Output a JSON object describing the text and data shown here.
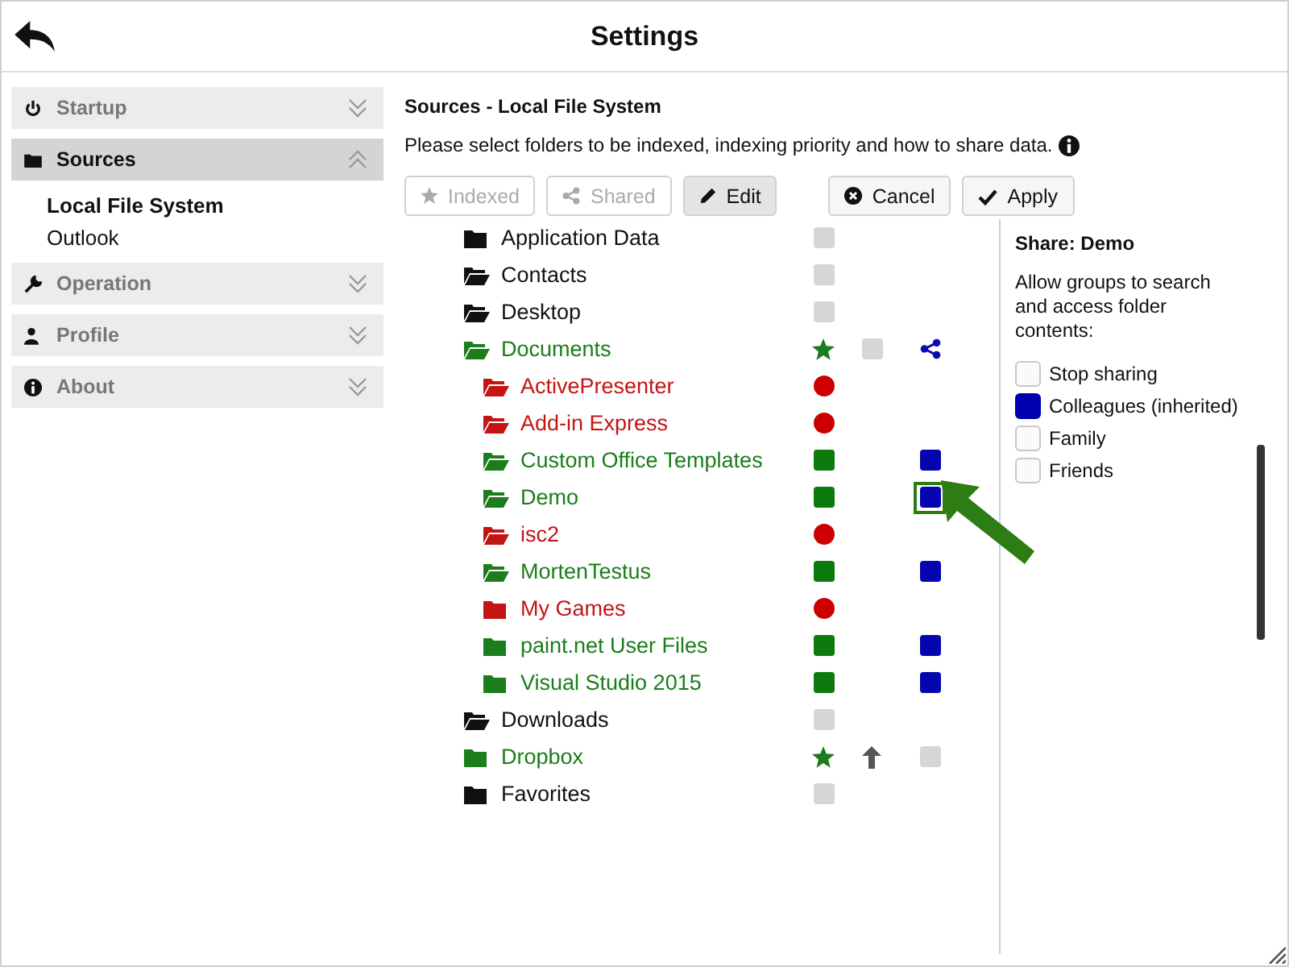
{
  "window": {
    "title": "Settings"
  },
  "sidebar": {
    "sections": [
      {
        "label": "Startup",
        "expanded": false
      },
      {
        "label": "Sources",
        "expanded": true,
        "items": [
          {
            "label": "Local File System",
            "selected": true
          },
          {
            "label": "Outlook",
            "selected": false
          }
        ]
      },
      {
        "label": "Operation",
        "expanded": false
      },
      {
        "label": "Profile",
        "expanded": false
      },
      {
        "label": "About",
        "expanded": false
      }
    ]
  },
  "content": {
    "heading": "Sources - Local File System",
    "description": "Please select folders to be indexed, indexing priority and how to share data.",
    "toolbar": [
      {
        "label": "Indexed",
        "disabled": true,
        "pressed": false
      },
      {
        "label": "Shared",
        "disabled": true,
        "pressed": false
      },
      {
        "label": "Edit",
        "disabled": false,
        "pressed": true
      }
    ],
    "actions": [
      {
        "label": "Cancel"
      },
      {
        "label": "Apply"
      }
    ],
    "tree": [
      {
        "name": "Application Data",
        "color": "#111111",
        "open": false,
        "index": {
          "kind": "inherit"
        },
        "selected": false
      },
      {
        "name": "Contacts",
        "color": "#111111",
        "open": true,
        "index": {
          "kind": "inherit"
        },
        "selected": false
      },
      {
        "name": "Desktop",
        "color": "#111111",
        "open": true,
        "index": {
          "kind": "inherit"
        },
        "selected": false
      },
      {
        "name": "Documents",
        "color": "#1b7d1b",
        "open": true,
        "index": {
          "kind": "star"
        },
        "sync": {
          "kind": "square"
        },
        "share": {
          "kind": "share"
        },
        "selected": false,
        "children": [
          {
            "name": "ActivePresenter",
            "color": "#c41414",
            "open": true,
            "index": {
              "kind": "dot"
            },
            "selected": false
          },
          {
            "name": "Add-in Express",
            "color": "#c41414",
            "open": true,
            "index": {
              "kind": "dot"
            },
            "selected": false
          },
          {
            "name": "Custom Office Templates",
            "color": "#1b7d1b",
            "open": true,
            "index": {
              "kind": "square"
            },
            "share": {
              "kind": "square"
            },
            "selected": false
          },
          {
            "name": "Demo",
            "color": "#1b7d1b",
            "open": true,
            "index": {
              "kind": "square"
            },
            "share": {
              "kind": "square"
            },
            "selected": true
          },
          {
            "name": "isc2",
            "color": "#c41414",
            "open": true,
            "index": {
              "kind": "dot"
            },
            "selected": false
          },
          {
            "name": "MortenTestus",
            "color": "#1b7d1b",
            "open": true,
            "index": {
              "kind": "square"
            },
            "share": {
              "kind": "square"
            },
            "selected": false
          },
          {
            "name": "My Games",
            "color": "#c41414",
            "open": false,
            "index": {
              "kind": "dot"
            },
            "selected": false
          },
          {
            "name": "paint.net User Files",
            "color": "#1b7d1b",
            "open": false,
            "index": {
              "kind": "square"
            },
            "share": {
              "kind": "square"
            },
            "selected": false
          },
          {
            "name": "Visual Studio 2015",
            "color": "#1b7d1b",
            "open": false,
            "index": {
              "kind": "square"
            },
            "share": {
              "kind": "square"
            },
            "selected": false
          }
        ]
      },
      {
        "name": "Downloads",
        "color": "#111111",
        "open": true,
        "index": {
          "kind": "inherit"
        },
        "selected": false
      },
      {
        "name": "Dropbox",
        "color": "#1b7d1b",
        "open": false,
        "index": {
          "kind": "star"
        },
        "sync": {
          "kind": "up"
        },
        "share": {
          "kind": "grey"
        },
        "selected": false
      },
      {
        "name": "Favorites",
        "color": "#111111",
        "open": false,
        "index": {
          "kind": "inherit"
        },
        "selected": false
      }
    ],
    "share_panel": {
      "title": "Share: Demo",
      "description": "Allow groups to search and access folder contents:",
      "groups": [
        {
          "label": "Stop sharing",
          "checked": false
        },
        {
          "label": "Colleagues (inherited)",
          "checked": true
        },
        {
          "label": "Family",
          "checked": false
        },
        {
          "label": "Friends",
          "checked": false
        }
      ]
    }
  }
}
